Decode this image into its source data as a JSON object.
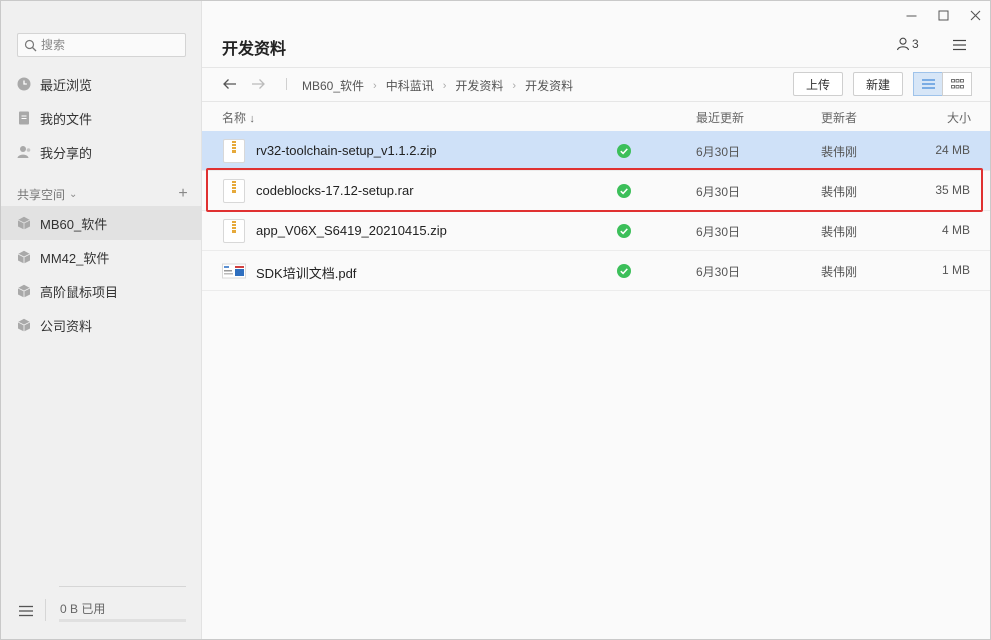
{
  "colors": {
    "accent": "#3b86d8",
    "selected_row": "#cfe1f8",
    "sync_ok": "#3cbf5a",
    "highlight": "#e03131"
  },
  "sidebar": {
    "search_placeholder": "搜索",
    "nav": [
      {
        "label": "最近浏览",
        "icon": "clock-icon"
      },
      {
        "label": "我的文件",
        "icon": "document-icon"
      },
      {
        "label": "我分享的",
        "icon": "user-share-icon"
      }
    ],
    "shared_section_label": "共享空间",
    "spaces": [
      {
        "label": "MB60_软件",
        "icon": "cube-icon",
        "active": true
      },
      {
        "label": "MM42_软件",
        "icon": "cube-icon",
        "active": false
      },
      {
        "label": "高阶鼠标项目",
        "icon": "cube-icon",
        "active": false
      },
      {
        "label": "公司资料",
        "icon": "cube-icon",
        "active": false
      }
    ],
    "usage_text": "0 B 已用",
    "usage_fraction": 0
  },
  "main": {
    "title": "开发资料",
    "member_count": "3",
    "breadcrumb": [
      "MB60_软件",
      "中科蓝讯",
      "开发资料",
      "开发资料"
    ],
    "upload_label": "上传",
    "new_label": "新建",
    "columns": {
      "name": "名称",
      "updated": "最近更新",
      "updater": "更新者",
      "size": "大小"
    },
    "files": [
      {
        "name": "rv32-toolchain-setup_v1.1.2.zip",
        "date": "6月30日",
        "user": "裴伟刚",
        "size": "24 MB",
        "type": "archive",
        "selected": true
      },
      {
        "name": "codeblocks-17.12-setup.rar",
        "date": "6月30日",
        "user": "裴伟刚",
        "size": "35 MB",
        "type": "archive",
        "selected": false
      },
      {
        "name": "app_V06X_S6419_20210415.zip",
        "date": "6月30日",
        "user": "裴伟刚",
        "size": "4 MB",
        "type": "archive",
        "selected": false
      },
      {
        "name": "SDK培训文档.pdf",
        "date": "6月30日",
        "user": "裴伟刚",
        "size": "1 MB",
        "type": "pdf",
        "selected": false
      }
    ]
  }
}
